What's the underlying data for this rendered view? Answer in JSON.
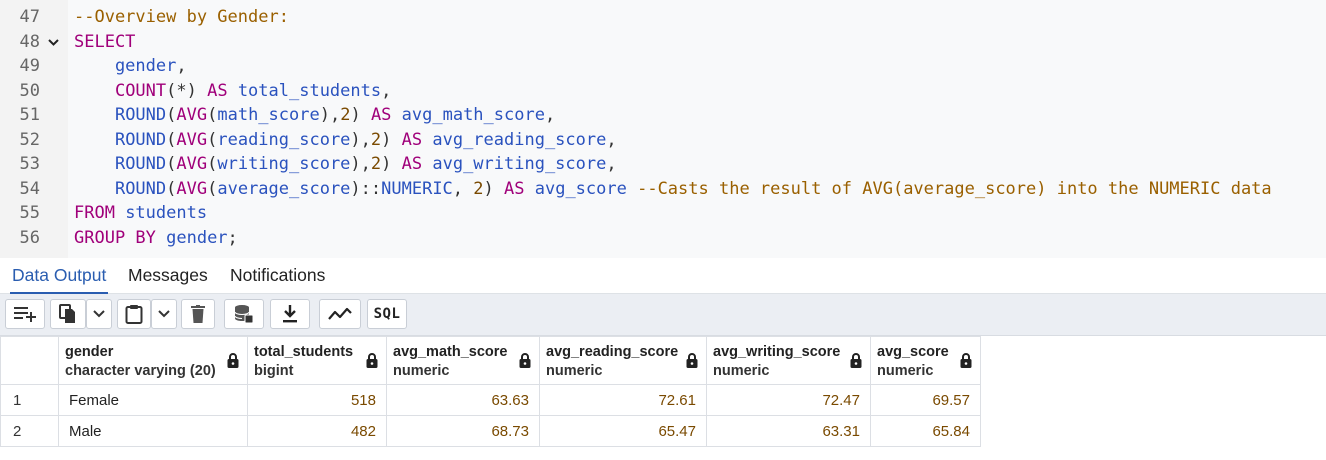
{
  "editor": {
    "lines": [
      {
        "n": "47",
        "tokens": [
          {
            "t": "--Overview by Gender:",
            "c": "cm"
          }
        ]
      },
      {
        "n": "48",
        "fold": true,
        "tokens": [
          {
            "t": "SELECT",
            "c": "kw"
          }
        ]
      },
      {
        "n": "49",
        "tokens": [
          {
            "t": "    gender",
            "c": "id"
          },
          {
            "t": ",",
            "c": "pl"
          }
        ]
      },
      {
        "n": "50",
        "tokens": [
          {
            "t": "    ",
            "c": "pl"
          },
          {
            "t": "COUNT",
            "c": "kw"
          },
          {
            "t": "(*) ",
            "c": "pl"
          },
          {
            "t": "AS",
            "c": "kw"
          },
          {
            "t": " total_students",
            "c": "id"
          },
          {
            "t": ",",
            "c": "pl"
          }
        ]
      },
      {
        "n": "51",
        "tokens": [
          {
            "t": "    ",
            "c": "pl"
          },
          {
            "t": "ROUND",
            "c": "fn"
          },
          {
            "t": "(",
            "c": "pl"
          },
          {
            "t": "AVG",
            "c": "kw"
          },
          {
            "t": "(",
            "c": "pl"
          },
          {
            "t": "math_score",
            "c": "id"
          },
          {
            "t": "),",
            "c": "pl"
          },
          {
            "t": "2",
            "c": "num"
          },
          {
            "t": ") ",
            "c": "pl"
          },
          {
            "t": "AS",
            "c": "kw"
          },
          {
            "t": " avg_math_score",
            "c": "id"
          },
          {
            "t": ",",
            "c": "pl"
          }
        ]
      },
      {
        "n": "52",
        "tokens": [
          {
            "t": "    ",
            "c": "pl"
          },
          {
            "t": "ROUND",
            "c": "fn"
          },
          {
            "t": "(",
            "c": "pl"
          },
          {
            "t": "AVG",
            "c": "kw"
          },
          {
            "t": "(",
            "c": "pl"
          },
          {
            "t": "reading_score",
            "c": "id"
          },
          {
            "t": "),",
            "c": "pl"
          },
          {
            "t": "2",
            "c": "num"
          },
          {
            "t": ") ",
            "c": "pl"
          },
          {
            "t": "AS",
            "c": "kw"
          },
          {
            "t": " avg_reading_score",
            "c": "id"
          },
          {
            "t": ",",
            "c": "pl"
          }
        ]
      },
      {
        "n": "53",
        "tokens": [
          {
            "t": "    ",
            "c": "pl"
          },
          {
            "t": "ROUND",
            "c": "fn"
          },
          {
            "t": "(",
            "c": "pl"
          },
          {
            "t": "AVG",
            "c": "kw"
          },
          {
            "t": "(",
            "c": "pl"
          },
          {
            "t": "writing_score",
            "c": "id"
          },
          {
            "t": "),",
            "c": "pl"
          },
          {
            "t": "2",
            "c": "num"
          },
          {
            "t": ") ",
            "c": "pl"
          },
          {
            "t": "AS",
            "c": "kw"
          },
          {
            "t": " avg_writing_score",
            "c": "id"
          },
          {
            "t": ",",
            "c": "pl"
          }
        ]
      },
      {
        "n": "54",
        "tokens": [
          {
            "t": "    ",
            "c": "pl"
          },
          {
            "t": "ROUND",
            "c": "fn"
          },
          {
            "t": "(",
            "c": "pl"
          },
          {
            "t": "AVG",
            "c": "kw"
          },
          {
            "t": "(",
            "c": "pl"
          },
          {
            "t": "average_score",
            "c": "id"
          },
          {
            "t": ")::",
            "c": "pl"
          },
          {
            "t": "NUMERIC",
            "c": "fn"
          },
          {
            "t": ", ",
            "c": "pl"
          },
          {
            "t": "2",
            "c": "num"
          },
          {
            "t": ") ",
            "c": "pl"
          },
          {
            "t": "AS",
            "c": "kw"
          },
          {
            "t": " avg_score ",
            "c": "id"
          },
          {
            "t": "--Casts the result of AVG(average_score) into the NUMERIC data",
            "c": "cm"
          }
        ]
      },
      {
        "n": "55",
        "tokens": [
          {
            "t": "FROM",
            "c": "kw"
          },
          {
            "t": " students",
            "c": "id"
          }
        ]
      },
      {
        "n": "56",
        "tokens": [
          {
            "t": "GROUP BY",
            "c": "kw"
          },
          {
            "t": " gender",
            "c": "id"
          },
          {
            "t": ";",
            "c": "pl"
          }
        ]
      }
    ]
  },
  "tabs": [
    {
      "label": "Data Output",
      "active": true
    },
    {
      "label": "Messages",
      "active": false
    },
    {
      "label": "Notifications",
      "active": false
    }
  ],
  "toolbar": {
    "sql_label": "SQL",
    "icons": [
      "add-row-icon",
      "copy-icon",
      "copy-dropdown-icon",
      "paste-icon",
      "paste-dropdown-icon",
      "delete-icon",
      "save-data-icon",
      "download-icon",
      "graph-icon"
    ]
  },
  "grid": {
    "columns": [
      {
        "name": "gender",
        "type": "character varying (20)"
      },
      {
        "name": "total_students",
        "type": "bigint"
      },
      {
        "name": "avg_math_score",
        "type": "numeric"
      },
      {
        "name": "avg_reading_score",
        "type": "numeric"
      },
      {
        "name": "avg_writing_score",
        "type": "numeric"
      },
      {
        "name": "avg_score",
        "type": "numeric"
      }
    ],
    "rows": [
      {
        "n": "1",
        "cells": [
          "Female",
          "518",
          "63.63",
          "72.61",
          "72.47",
          "69.57"
        ]
      },
      {
        "n": "2",
        "cells": [
          "Male",
          "482",
          "68.73",
          "65.47",
          "63.31",
          "65.84"
        ]
      }
    ]
  }
}
